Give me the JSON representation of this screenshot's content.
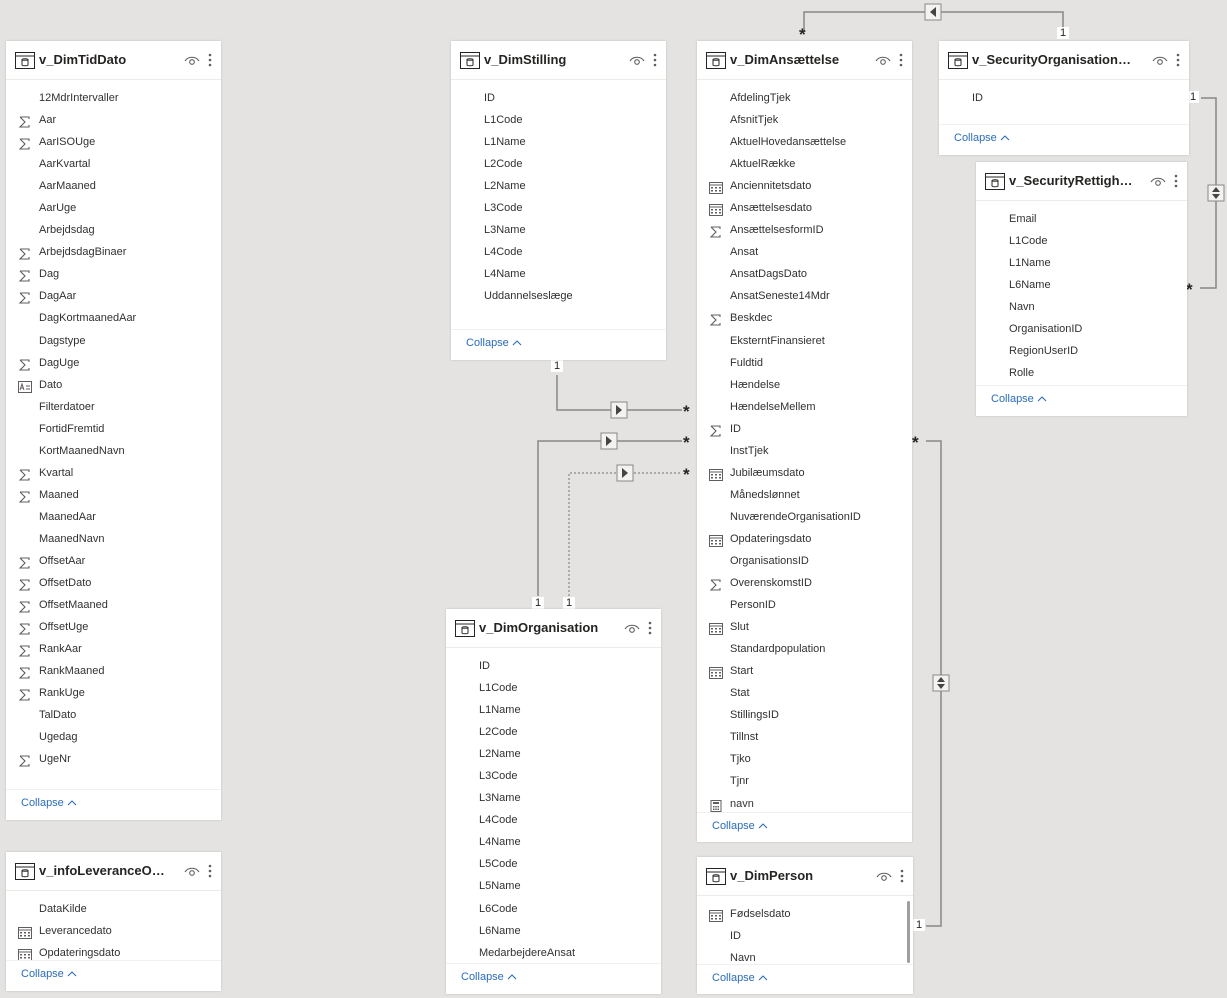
{
  "collapse_label": "Collapse",
  "cardinality": {
    "one": "1",
    "many": "*"
  },
  "tables": [
    {
      "id": "v_DimTidDato",
      "title": "v_DimTidDato",
      "fields": [
        {
          "label": "12MdrIntervaller",
          "icon": "none"
        },
        {
          "label": "Aar",
          "icon": "sum"
        },
        {
          "label": "AarISOUge",
          "icon": "sum"
        },
        {
          "label": "AarKvartal",
          "icon": "none"
        },
        {
          "label": "AarMaaned",
          "icon": "none"
        },
        {
          "label": "AarUge",
          "icon": "none"
        },
        {
          "label": "Arbejdsdag",
          "icon": "none"
        },
        {
          "label": "ArbejdsdagBinaer",
          "icon": "sum"
        },
        {
          "label": "Dag",
          "icon": "sum"
        },
        {
          "label": "DagAar",
          "icon": "sum"
        },
        {
          "label": "DagKortmaanedAar",
          "icon": "none"
        },
        {
          "label": "Dagstype",
          "icon": "none"
        },
        {
          "label": "DagUge",
          "icon": "sum"
        },
        {
          "label": "Dato",
          "icon": "text"
        },
        {
          "label": "Filterdatoer",
          "icon": "none"
        },
        {
          "label": "FortidFremtid",
          "icon": "none"
        },
        {
          "label": "KortMaanedNavn",
          "icon": "none"
        },
        {
          "label": "Kvartal",
          "icon": "sum"
        },
        {
          "label": "Maaned",
          "icon": "sum"
        },
        {
          "label": "MaanedAar",
          "icon": "none"
        },
        {
          "label": "MaanedNavn",
          "icon": "none"
        },
        {
          "label": "OffsetAar",
          "icon": "sum"
        },
        {
          "label": "OffsetDato",
          "icon": "sum"
        },
        {
          "label": "OffsetMaaned",
          "icon": "sum"
        },
        {
          "label": "OffsetUge",
          "icon": "sum"
        },
        {
          "label": "RankAar",
          "icon": "sum"
        },
        {
          "label": "RankMaaned",
          "icon": "sum"
        },
        {
          "label": "RankUge",
          "icon": "sum"
        },
        {
          "label": "TalDato",
          "icon": "none"
        },
        {
          "label": "Ugedag",
          "icon": "none"
        },
        {
          "label": "UgeNr",
          "icon": "sum"
        }
      ]
    },
    {
      "id": "v_DimStilling",
      "title": "v_DimStilling",
      "fields": [
        {
          "label": "ID",
          "icon": "none"
        },
        {
          "label": "L1Code",
          "icon": "none"
        },
        {
          "label": "L1Name",
          "icon": "none"
        },
        {
          "label": "L2Code",
          "icon": "none"
        },
        {
          "label": "L2Name",
          "icon": "none"
        },
        {
          "label": "L3Code",
          "icon": "none"
        },
        {
          "label": "L3Name",
          "icon": "none"
        },
        {
          "label": "L4Code",
          "icon": "none"
        },
        {
          "label": "L4Name",
          "icon": "none"
        },
        {
          "label": "Uddannelseslæge",
          "icon": "none"
        }
      ]
    },
    {
      "id": "v_DimAnsaettelse",
      "title": "v_DimAnsættelse",
      "fields": [
        {
          "label": "AfdelingTjek",
          "icon": "none"
        },
        {
          "label": "AfsnitTjek",
          "icon": "none"
        },
        {
          "label": "AktuelHovedansættelse",
          "icon": "none"
        },
        {
          "label": "AktuelRække",
          "icon": "none"
        },
        {
          "label": "Anciennitetsdato",
          "icon": "calendar"
        },
        {
          "label": "Ansættelsesdato",
          "icon": "calendar"
        },
        {
          "label": "AnsættelsesformID",
          "icon": "sum"
        },
        {
          "label": "Ansat",
          "icon": "none"
        },
        {
          "label": "AnsatDagsDato",
          "icon": "none"
        },
        {
          "label": "AnsatSeneste14Mdr",
          "icon": "none"
        },
        {
          "label": "Beskdec",
          "icon": "sum"
        },
        {
          "label": "EksterntFinansieret",
          "icon": "none"
        },
        {
          "label": "Fuldtid",
          "icon": "none"
        },
        {
          "label": "Hændelse",
          "icon": "none"
        },
        {
          "label": "HændelseMellem",
          "icon": "none"
        },
        {
          "label": "ID",
          "icon": "sum"
        },
        {
          "label": "InstTjek",
          "icon": "none"
        },
        {
          "label": "Jubilæumsdato",
          "icon": "calendar"
        },
        {
          "label": "Månedslønnet",
          "icon": "none"
        },
        {
          "label": "NuværendeOrganisationID",
          "icon": "none"
        },
        {
          "label": "Opdateringsdato",
          "icon": "calendar"
        },
        {
          "label": "OrganisationsID",
          "icon": "none"
        },
        {
          "label": "OverenskomstID",
          "icon": "sum"
        },
        {
          "label": "PersonID",
          "icon": "none"
        },
        {
          "label": "Slut",
          "icon": "calendar"
        },
        {
          "label": "Standardpopulation",
          "icon": "none"
        },
        {
          "label": "Start",
          "icon": "calendar"
        },
        {
          "label": "Stat",
          "icon": "none"
        },
        {
          "label": "StillingsID",
          "icon": "none"
        },
        {
          "label": "Tillnst",
          "icon": "none"
        },
        {
          "label": "Tjko",
          "icon": "none"
        },
        {
          "label": "Tjnr",
          "icon": "none"
        },
        {
          "label": "navn",
          "icon": "calculator"
        }
      ]
    },
    {
      "id": "v_SecurityOrganisationBridge",
      "title": "v_SecurityOrganisationBridge",
      "fields": [
        {
          "label": "ID",
          "icon": "none"
        }
      ]
    },
    {
      "id": "v_SecurityRettigheder",
      "title": "v_SecurityRettigheder",
      "fields": [
        {
          "label": "Email",
          "icon": "none"
        },
        {
          "label": "L1Code",
          "icon": "none"
        },
        {
          "label": "L1Name",
          "icon": "none"
        },
        {
          "label": "L6Name",
          "icon": "none"
        },
        {
          "label": "Navn",
          "icon": "none"
        },
        {
          "label": "OrganisationID",
          "icon": "none"
        },
        {
          "label": "RegionUserID",
          "icon": "none"
        },
        {
          "label": "Rolle",
          "icon": "none"
        }
      ]
    },
    {
      "id": "v_DimOrganisation",
      "title": "v_DimOrganisation",
      "fields": [
        {
          "label": "ID",
          "icon": "none"
        },
        {
          "label": "L1Code",
          "icon": "none"
        },
        {
          "label": "L1Name",
          "icon": "none"
        },
        {
          "label": "L2Code",
          "icon": "none"
        },
        {
          "label": "L2Name",
          "icon": "none"
        },
        {
          "label": "L3Code",
          "icon": "none"
        },
        {
          "label": "L3Name",
          "icon": "none"
        },
        {
          "label": "L4Code",
          "icon": "none"
        },
        {
          "label": "L4Name",
          "icon": "none"
        },
        {
          "label": "L5Code",
          "icon": "none"
        },
        {
          "label": "L5Name",
          "icon": "none"
        },
        {
          "label": "L6Code",
          "icon": "none"
        },
        {
          "label": "L6Name",
          "icon": "none"
        },
        {
          "label": "MedarbejdereAnsat",
          "icon": "none"
        }
      ]
    },
    {
      "id": "v_infoLeveranceOpdatering",
      "title": "v_infoLeveranceOpda...",
      "fields": [
        {
          "label": "DataKilde",
          "icon": "none"
        },
        {
          "label": "Leverancedato",
          "icon": "calendar"
        },
        {
          "label": "Opdateringsdato",
          "icon": "calendar"
        }
      ]
    },
    {
      "id": "v_DimPerson",
      "title": "v_DimPerson",
      "fields": [
        {
          "label": "Fødselsdato",
          "icon": "calendar"
        },
        {
          "label": "ID",
          "icon": "none"
        },
        {
          "label": "Navn",
          "icon": "none"
        }
      ]
    }
  ]
}
